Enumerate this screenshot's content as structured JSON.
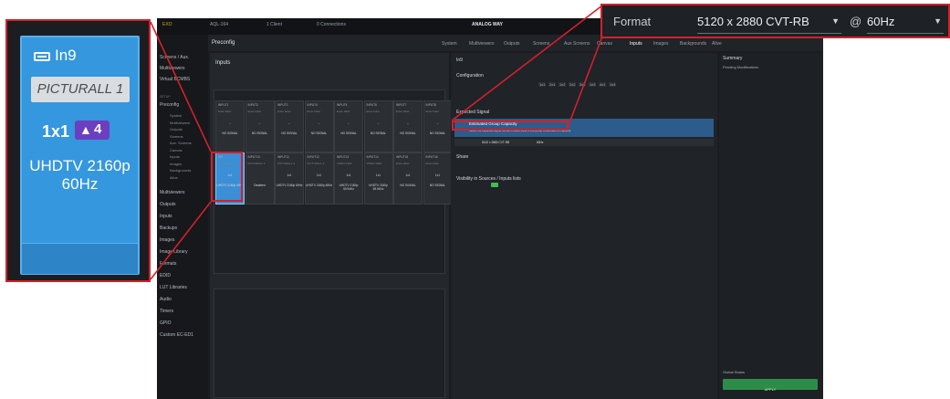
{
  "app": {
    "logo": "ANALOG WAY",
    "topbar": {
      "device": "AQL-164",
      "screen": "1 Client",
      "connections": "0 Connections",
      "menu": "EXO"
    },
    "page_title": "Preconfig",
    "nav": [
      "System",
      "Multiviewers",
      "Outputs",
      "Screens",
      "Aux Screens",
      "Canvas",
      "Inputs",
      "Images",
      "Backgrounds",
      "Alive"
    ],
    "nav_active": "Inputs",
    "sidebar": {
      "top_items": [
        "Screens / Aux.",
        "Multiviewers",
        "Virtual BCMBS"
      ],
      "section_setup": "SETUP",
      "preconfig": "Preconfig",
      "preconfig_sub": [
        "System",
        "Multiviewers",
        "Outputs",
        "Screens",
        "Aux. Screens",
        "Canvas",
        "Inputs",
        "Images",
        "Backgrounds",
        "Alive"
      ],
      "items": [
        "Multiviewers",
        "Outputs",
        "Inputs",
        "Backups",
        "Images",
        "Image Library",
        "Formats",
        "EDID",
        "LUT Libraries",
        "Audio",
        "Timers",
        "GPIO",
        "Custom EC-ED1"
      ]
    },
    "inputs_panel": {
      "title": "Inputs",
      "group_tag": "IN",
      "tiles": [
        {
          "name": "INPUT1",
          "label": "Enter label",
          "fmt": "--",
          "signal": "NO SIGNAL"
        },
        {
          "name": "INPUT2",
          "label": "Enter label",
          "fmt": "--",
          "signal": "NO SIGNAL"
        },
        {
          "name": "INPUT3",
          "label": "Enter label",
          "fmt": "--",
          "signal": "NO SIGNAL"
        },
        {
          "name": "INPUT4",
          "label": "Enter label",
          "fmt": "--",
          "signal": "NO SIGNAL"
        },
        {
          "name": "INPUT5",
          "label": "Enter label",
          "fmt": "--",
          "signal": "NO SIGNAL"
        },
        {
          "name": "INPUT6",
          "label": "Enter label",
          "fmt": "--",
          "signal": "NO SIGNAL"
        },
        {
          "name": "INPUT7",
          "label": "Enter label",
          "fmt": "--",
          "signal": "NO SIGNAL"
        },
        {
          "name": "INPUT8",
          "label": "Enter label",
          "fmt": "--",
          "signal": "NO SIGNAL"
        },
        {
          "name": "IN9",
          "label": "PICTURALL 1",
          "fmt": "1x1",
          "signal": "UHDTV 2160p 60Hz"
        },
        {
          "name": "INPUT10",
          "label": "PICTURALL 2",
          "fmt": "",
          "signal": "Disabled"
        },
        {
          "name": "INPUT11",
          "label": "PICTURALL 3",
          "fmt": "1x1",
          "signal": "UHDTV 2160p 60Hz"
        },
        {
          "name": "INPUT12",
          "label": "PICTURALL 4",
          "fmt": "1x1",
          "signal": "UHDTV 2160p 60Hz"
        },
        {
          "name": "INPUT13",
          "label": "VIDEO FEM",
          "fmt": "1x1",
          "signal": "UHDTV 2160p 59.94Hz"
        },
        {
          "name": "INPUT14",
          "label": "VIDEO FEM",
          "fmt": "1x1",
          "signal": "UHDTV 2160p 59.94Hz"
        },
        {
          "name": "INPUT15",
          "label": "Enter label",
          "fmt": "1x1",
          "signal": "NO SIGNAL"
        },
        {
          "name": "INPUT16",
          "label": "Enter label",
          "fmt": "1x1",
          "signal": "NO SIGNAL"
        }
      ]
    },
    "config_panel": {
      "input_name": "In9",
      "configuration_label": "Configuration",
      "layouts": [
        "1x1",
        "2x1",
        "1x2",
        "2x2",
        "3x1",
        "1x3",
        "4x1",
        "1x4"
      ],
      "expected_signal": "Expected Signal",
      "estimated_capacity": "Estimated Group Capacity",
      "capacity_hint": "Select the expected signal format on each input of the group to estimate its capacity.",
      "share": "Share",
      "visibility": "Visibility in Sources / Inputs lists"
    },
    "summary_panel": {
      "title": "Summary",
      "pending": "Pending Modifications",
      "global_status": "Global Status",
      "apply": "APPLY"
    }
  },
  "zoom_left": {
    "input_name": "In9",
    "label": "PICTURALL 1",
    "layout": "1x1",
    "badge": "4",
    "signal_line1": "UHDTV 2160p",
    "signal_line2": "60Hz"
  },
  "zoom_right": {
    "format_label": "Format",
    "format_value": "5120 x 2880 CVT-RB",
    "at": "@",
    "rate_value": "60Hz"
  },
  "colors": {
    "highlight_red": "#d4202b",
    "selected_blue": "#3597dd",
    "badge_purple": "#6c3fc0"
  }
}
